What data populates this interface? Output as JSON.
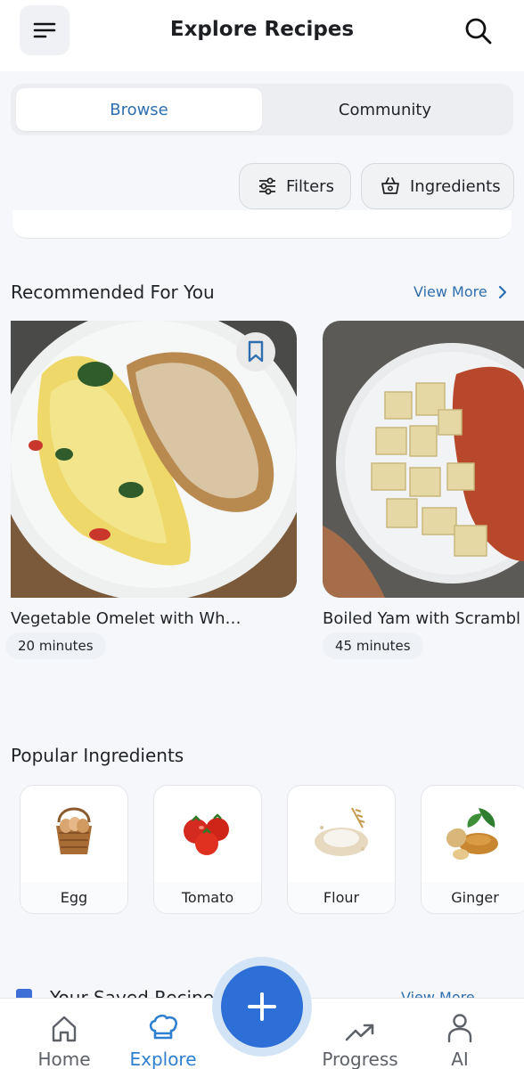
{
  "header": {
    "title": "Explore Recipes",
    "menu_icon": "menu-icon",
    "search_icon": "search-icon"
  },
  "tabs": [
    {
      "label": "Browse",
      "active": true
    },
    {
      "label": "Community",
      "active": false
    }
  ],
  "filters": {
    "filters_label": "Filters",
    "ingredients_label": "Ingredients"
  },
  "recommended": {
    "title": "Recommended For You",
    "view_more": "View More",
    "recipes": [
      {
        "name": "Vegetable Omelet with Wh…",
        "time": "20 minutes",
        "bookmarked": false
      },
      {
        "name": "Boiled Yam with Scrambl",
        "time": "45 minutes"
      }
    ]
  },
  "popular_ingredients": {
    "title": "Popular Ingredients",
    "items": [
      {
        "name": "Egg"
      },
      {
        "name": "Tomato"
      },
      {
        "name": "Flour"
      },
      {
        "name": "Ginger"
      }
    ]
  },
  "saved_recipes": {
    "title": "Your Saved Recipes",
    "view_more": "View More"
  },
  "bottom_nav": {
    "items": [
      {
        "label": "Home",
        "icon": "home-icon"
      },
      {
        "label": "Explore",
        "icon": "chef-hat-icon",
        "active": true
      },
      {
        "label": "Progress",
        "icon": "trending-up-icon"
      },
      {
        "label": "AI",
        "icon": "person-icon"
      }
    ],
    "fab_icon": "plus-icon"
  },
  "colors": {
    "accent": "#2d6fd6",
    "link": "#2f6fb0",
    "background": "#f5f7fa"
  }
}
